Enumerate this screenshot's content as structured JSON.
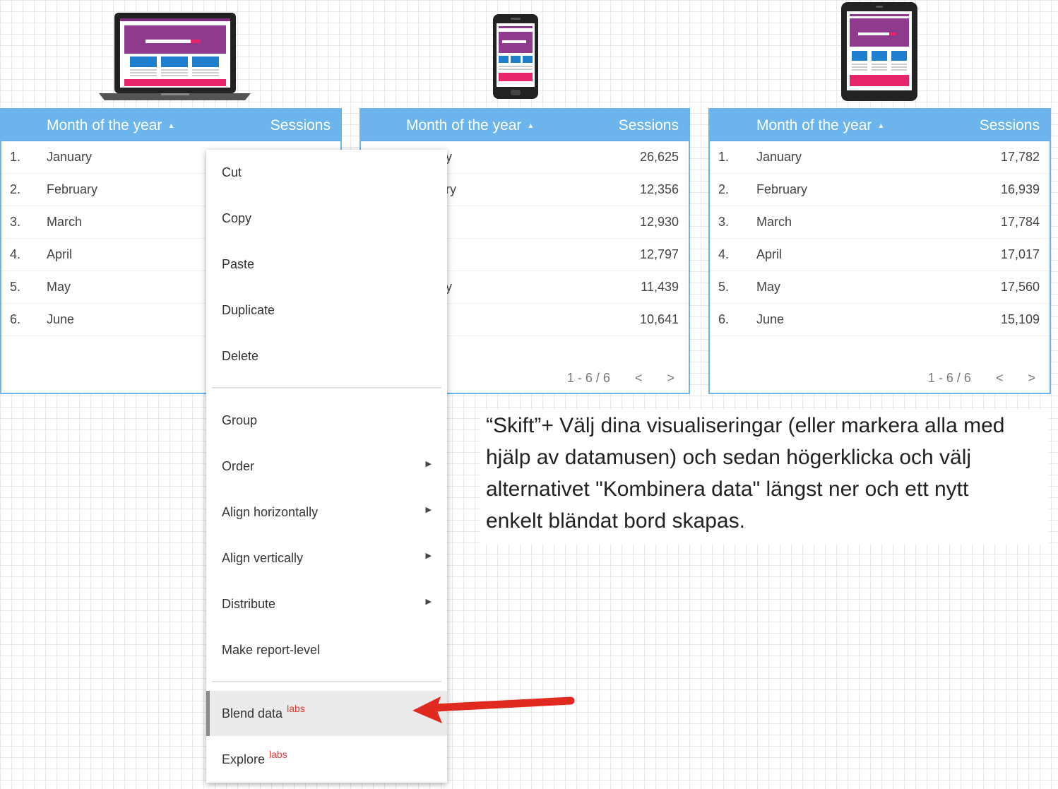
{
  "tables": [
    {
      "header": {
        "dimension": "Month of the year",
        "metric": "Sessions"
      },
      "rows": [
        {
          "index": "1.",
          "month": "January",
          "sessions": ""
        },
        {
          "index": "2.",
          "month": "February",
          "sessions": ""
        },
        {
          "index": "3.",
          "month": "March",
          "sessions": ""
        },
        {
          "index": "4.",
          "month": "April",
          "sessions": ""
        },
        {
          "index": "5.",
          "month": "May",
          "sessions": ""
        },
        {
          "index": "6.",
          "month": "June",
          "sessions": ""
        }
      ],
      "pagination": ""
    },
    {
      "header": {
        "dimension": "Month of the year",
        "metric": "Sessions"
      },
      "rows": [
        {
          "index": "",
          "month": "y",
          "sessions": "26,625"
        },
        {
          "index": "",
          "month": "ry",
          "sessions": "12,356"
        },
        {
          "index": "",
          "month": "",
          "sessions": "12,930"
        },
        {
          "index": "",
          "month": "",
          "sessions": "12,797"
        },
        {
          "index": "",
          "month": "y",
          "sessions": "11,439"
        },
        {
          "index": "",
          "month": "",
          "sessions": "10,641"
        }
      ],
      "pagination": "1 - 6 / 6"
    },
    {
      "header": {
        "dimension": "Month of the year",
        "metric": "Sessions"
      },
      "rows": [
        {
          "index": "1.",
          "month": "January",
          "sessions": "17,782"
        },
        {
          "index": "2.",
          "month": "February",
          "sessions": "16,939"
        },
        {
          "index": "3.",
          "month": "March",
          "sessions": "17,784"
        },
        {
          "index": "4.",
          "month": "April",
          "sessions": "17,017"
        },
        {
          "index": "5.",
          "month": "May",
          "sessions": "17,560"
        },
        {
          "index": "6.",
          "month": "June",
          "sessions": "15,109"
        }
      ],
      "pagination": "1 - 6 / 6"
    }
  ],
  "icons": {
    "sort": "sort-up-icon",
    "prev": "chevron-left-icon",
    "next": "chevron-right-icon",
    "submenu": "caret-right-icon"
  },
  "context_menu": {
    "cut": "Cut",
    "copy": "Copy",
    "paste": "Paste",
    "duplicate": "Duplicate",
    "delete": "Delete",
    "group": "Group",
    "order": "Order",
    "align_horizontally": "Align horizontally",
    "align_vertically": "Align vertically",
    "distribute": "Distribute",
    "make_report_level": "Make report-level",
    "blend_data": "Blend data",
    "explore": "Explore",
    "labs_badge": "labs"
  },
  "caption": {
    "line1": "“Skift”+ Välj dina visualiseringar (eller markera alla med",
    "line2": "hjälp av datamusen) och sedan högerklicka och välj",
    "line3": "alternativet \"Kombinera data\" längst ner och ett nytt",
    "line4": "enkelt bländat bord skapas."
  },
  "colors": {
    "table_header": "#6cb5ec",
    "device_purple": "#8e3b8f",
    "device_blue": "#1f7fcf",
    "device_pink": "#e8246d",
    "arrow_red": "#e02a1f",
    "labs_red": "#e53935"
  }
}
